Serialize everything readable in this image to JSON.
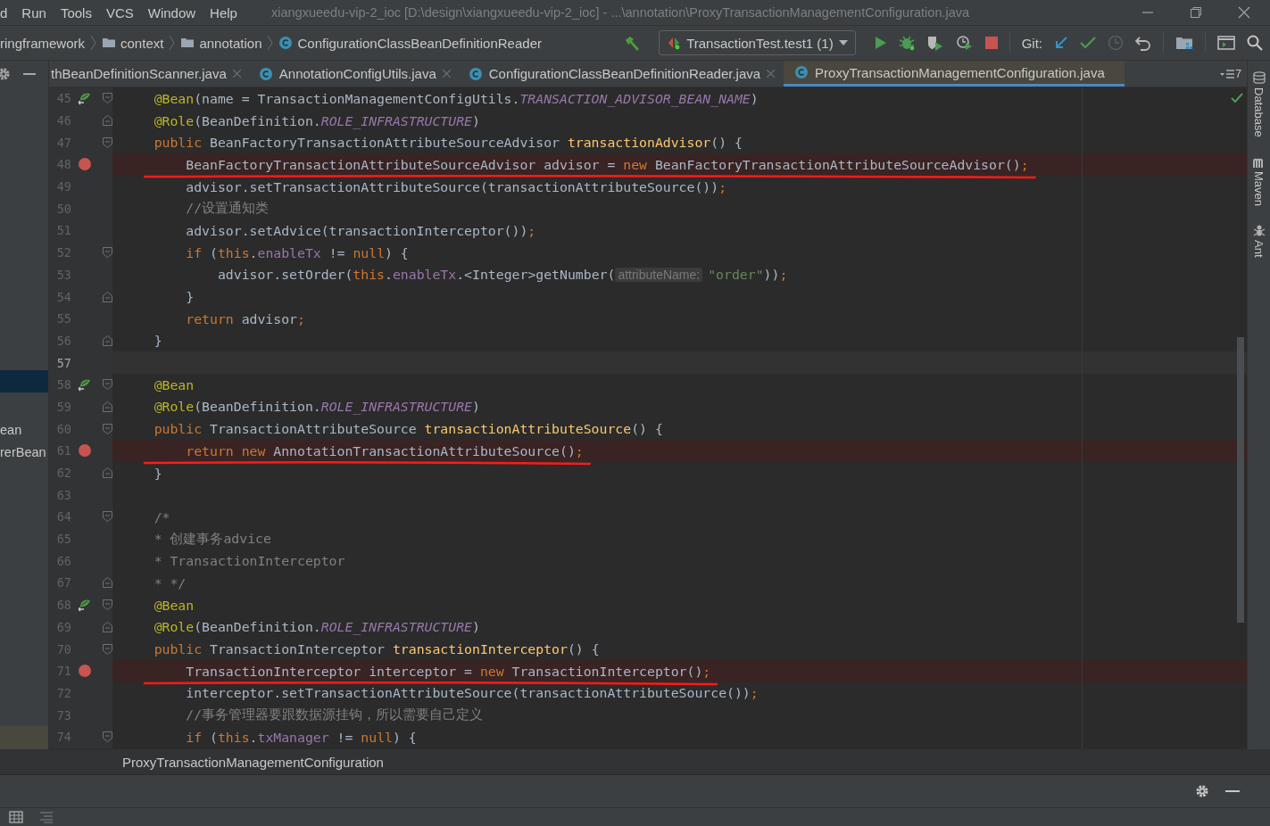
{
  "menu": [
    "d",
    "Run",
    "Tools",
    "VCS",
    "Window",
    "Help"
  ],
  "window": {
    "title": "xiangxueedu-vip-2_ioc [D:\\design\\xiangxueedu-vip-2_ioc] - ...\\annotation\\ProxyTransactionManagementConfiguration.java"
  },
  "breadcrumbs": [
    {
      "label": "ringframework",
      "kind": "package"
    },
    {
      "label": "context",
      "kind": "folder"
    },
    {
      "label": "annotation",
      "kind": "folder"
    },
    {
      "label": "ConfigurationClassBeanDefinitionReader",
      "kind": "class"
    }
  ],
  "run_config": {
    "label": "TransactionTest.test1 (1)"
  },
  "vcs_label": "Git:",
  "tabs": [
    {
      "label": "thBeanDefinitionScanner.java",
      "selected": false,
      "closable": true
    },
    {
      "label": "AnnotationConfigUtils.java",
      "selected": false,
      "closable": true
    },
    {
      "label": "ConfigurationClassBeanDefinitionReader.java",
      "selected": false,
      "closable": true
    },
    {
      "label": "ProxyTransactionManagementConfiguration.java",
      "selected": true,
      "closable": false
    }
  ],
  "tab_count": "7",
  "project_panel": {
    "items": [
      {
        "selected": true
      },
      {
        "label": "ean",
        "selected": false
      },
      {
        "label": "rerBean",
        "selected": false
      }
    ]
  },
  "editor": {
    "lines": [
      {
        "number": "45",
        "bean": true,
        "fold_start": true,
        "tokens": [
          {
            "text": "    @Bean",
            "kind": "annotation"
          },
          {
            "text": "(name = TransactionManagementConfigUtils.",
            "kind": "plain"
          },
          {
            "text": "TRANSACTION_ADVISOR_BEAN_NAME",
            "kind": "constant"
          },
          {
            "text": ")",
            "kind": "plain"
          }
        ]
      },
      {
        "number": "46",
        "fold_end": true,
        "tokens": [
          {
            "text": "    @Role",
            "kind": "annotation"
          },
          {
            "text": "(BeanDefinition.",
            "kind": "plain"
          },
          {
            "text": "ROLE_INFRASTRUCTURE",
            "kind": "constant"
          },
          {
            "text": ")",
            "kind": "plain"
          }
        ]
      },
      {
        "number": "47",
        "fold_start": true,
        "tokens": [
          {
            "text": "    public ",
            "kind": "keyword"
          },
          {
            "text": "BeanFactoryTransactionAttributeSourceAdvisor ",
            "kind": "plain"
          },
          {
            "text": "transactionAdvisor",
            "kind": "method"
          },
          {
            "text": "() {",
            "kind": "plain"
          }
        ]
      },
      {
        "number": "48",
        "breakpoint": true,
        "underlined": true,
        "tokens": [
          {
            "text": "        BeanFactoryTransactionAttributeSourceAdvisor advisor = ",
            "kind": "plain"
          },
          {
            "text": "new ",
            "kind": "keyword"
          },
          {
            "text": "BeanFactoryTransactionAttributeSourceAdvisor()",
            "kind": "plain"
          },
          {
            "text": ";",
            "kind": "keyword"
          }
        ]
      },
      {
        "number": "49",
        "tokens": [
          {
            "text": "        advisor.setTransactionAttributeSource(transactionAttributeSource())",
            "kind": "plain"
          },
          {
            "text": ";",
            "kind": "keyword"
          }
        ]
      },
      {
        "number": "50",
        "tokens": [
          {
            "text": "        //设置通知类",
            "kind": "comment"
          }
        ]
      },
      {
        "number": "51",
        "tokens": [
          {
            "text": "        advisor.setAdvice(transactionInterceptor())",
            "kind": "plain"
          },
          {
            "text": ";",
            "kind": "keyword"
          }
        ]
      },
      {
        "number": "52",
        "fold_start": true,
        "tokens": [
          {
            "text": "        if ",
            "kind": "keyword"
          },
          {
            "text": "(",
            "kind": "plain"
          },
          {
            "text": "this",
            "kind": "keyword"
          },
          {
            "text": ".",
            "kind": "plain"
          },
          {
            "text": "enableTx ",
            "kind": "field"
          },
          {
            "text": "!= ",
            "kind": "plain"
          },
          {
            "text": "null",
            "kind": "keyword"
          },
          {
            "text": ") {",
            "kind": "plain"
          }
        ]
      },
      {
        "number": "53",
        "tokens": [
          {
            "text": "            advisor.setOrder(",
            "kind": "plain"
          },
          {
            "text": "this",
            "kind": "keyword"
          },
          {
            "text": ".",
            "kind": "plain"
          },
          {
            "text": "enableTx",
            "kind": "field"
          },
          {
            "text": ".<Integer>getNumber(",
            "kind": "plain"
          },
          {
            "text": "attributeName:",
            "kind": "hint"
          },
          {
            "text": "\"order\"",
            "kind": "string"
          },
          {
            "text": "))",
            "kind": "plain"
          },
          {
            "text": ";",
            "kind": "keyword"
          }
        ]
      },
      {
        "number": "54",
        "fold_end": true,
        "tokens": [
          {
            "text": "        }",
            "kind": "plain"
          }
        ]
      },
      {
        "number": "55",
        "tokens": [
          {
            "text": "        return ",
            "kind": "keyword"
          },
          {
            "text": "advisor",
            "kind": "plain"
          },
          {
            "text": ";",
            "kind": "keyword"
          }
        ]
      },
      {
        "number": "56",
        "fold_end": true,
        "tokens": [
          {
            "text": "    }",
            "kind": "plain"
          }
        ]
      },
      {
        "number": "57",
        "current": true
      },
      {
        "number": "58",
        "bean": true,
        "fold_start": true,
        "tokens": [
          {
            "text": "    @Bean",
            "kind": "annotation"
          }
        ]
      },
      {
        "number": "59",
        "fold_end": true,
        "tokens": [
          {
            "text": "    @Role",
            "kind": "annotation"
          },
          {
            "text": "(BeanDefinition.",
            "kind": "plain"
          },
          {
            "text": "ROLE_INFRASTRUCTURE",
            "kind": "constant"
          },
          {
            "text": ")",
            "kind": "plain"
          }
        ]
      },
      {
        "number": "60",
        "fold_start": true,
        "tokens": [
          {
            "text": "    public ",
            "kind": "keyword"
          },
          {
            "text": "TransactionAttributeSource ",
            "kind": "plain"
          },
          {
            "text": "transactionAttributeSource",
            "kind": "method"
          },
          {
            "text": "() {",
            "kind": "plain"
          }
        ]
      },
      {
        "number": "61",
        "breakpoint": true,
        "underlined": true,
        "tokens": [
          {
            "text": "        return new ",
            "kind": "keyword"
          },
          {
            "text": "AnnotationTransactionAttributeSource()",
            "kind": "plain"
          },
          {
            "text": ";",
            "kind": "keyword"
          }
        ]
      },
      {
        "number": "62",
        "fold_end": true,
        "tokens": [
          {
            "text": "    }",
            "kind": "plain"
          }
        ]
      },
      {
        "number": "63"
      },
      {
        "number": "64",
        "fold_start": true,
        "tokens": [
          {
            "text": "    /*",
            "kind": "comment"
          }
        ]
      },
      {
        "number": "65",
        "tokens": [
          {
            "text": "    * 创建事务advice",
            "kind": "comment"
          }
        ]
      },
      {
        "number": "66",
        "tokens": [
          {
            "text": "    * TransactionInterceptor",
            "kind": "comment"
          }
        ]
      },
      {
        "number": "67",
        "fold_end": true,
        "tokens": [
          {
            "text": "    * */",
            "kind": "comment"
          }
        ]
      },
      {
        "number": "68",
        "bean": true,
        "fold_start": true,
        "tokens": [
          {
            "text": "    @Bean",
            "kind": "annotation"
          }
        ]
      },
      {
        "number": "69",
        "fold_end": true,
        "tokens": [
          {
            "text": "    @Role",
            "kind": "annotation"
          },
          {
            "text": "(BeanDefinition.",
            "kind": "plain"
          },
          {
            "text": "ROLE_INFRASTRUCTURE",
            "kind": "constant"
          },
          {
            "text": ")",
            "kind": "plain"
          }
        ]
      },
      {
        "number": "70",
        "fold_start": true,
        "tokens": [
          {
            "text": "    public ",
            "kind": "keyword"
          },
          {
            "text": "TransactionInterceptor ",
            "kind": "plain"
          },
          {
            "text": "transactionInterceptor",
            "kind": "method"
          },
          {
            "text": "() {",
            "kind": "plain"
          }
        ]
      },
      {
        "number": "71",
        "breakpoint": true,
        "underlined": true,
        "tokens": [
          {
            "text": "        TransactionInterceptor interceptor = ",
            "kind": "plain"
          },
          {
            "text": "new ",
            "kind": "keyword"
          },
          {
            "text": "TransactionInterceptor()",
            "kind": "plain"
          },
          {
            "text": ";",
            "kind": "keyword"
          }
        ]
      },
      {
        "number": "72",
        "tokens": [
          {
            "text": "        interceptor.setTransactionAttributeSource(transactionAttributeSource())",
            "kind": "plain"
          },
          {
            "text": ";",
            "kind": "keyword"
          }
        ]
      },
      {
        "number": "73",
        "tokens": [
          {
            "text": "        //事务管理器要跟数据源挂钩，所以需要自己定义",
            "kind": "comment"
          }
        ]
      },
      {
        "number": "74",
        "fold_start": true,
        "tokens": [
          {
            "text": "        if ",
            "kind": "keyword"
          },
          {
            "text": "(",
            "kind": "plain"
          },
          {
            "text": "this",
            "kind": "keyword"
          },
          {
            "text": ".",
            "kind": "plain"
          },
          {
            "text": "txManager ",
            "kind": "field"
          },
          {
            "text": "!= ",
            "kind": "plain"
          },
          {
            "text": "null",
            "kind": "keyword"
          },
          {
            "text": ") {",
            "kind": "plain"
          }
        ]
      }
    ]
  },
  "side_tools": [
    {
      "label": "Database",
      "kind": "database"
    },
    {
      "label": "Maven",
      "kind": "maven"
    },
    {
      "label": "Ant",
      "kind": "ant"
    }
  ],
  "footer_breadcrumb": "ProxyTransactionManagementConfiguration"
}
